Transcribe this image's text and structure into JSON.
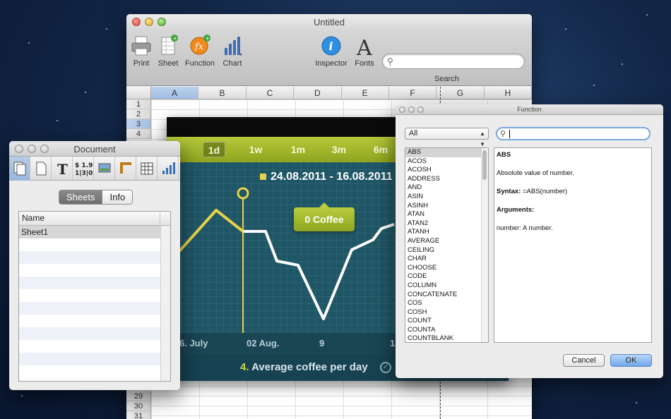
{
  "main_window": {
    "title": "Untitled",
    "toolbar": {
      "print": "Print",
      "sheet": "Sheet",
      "function": "Function",
      "chart": "Chart",
      "inspector": "Inspector",
      "fonts": "Fonts",
      "search": "Search"
    },
    "columns": [
      "A",
      "B",
      "C",
      "D",
      "E",
      "F",
      "G",
      "H"
    ],
    "rows_top": [
      "1",
      "2",
      "3",
      "4"
    ],
    "rows_bottom": [
      "29",
      "30",
      "31"
    ],
    "selected_column": "A",
    "selected_row": "3"
  },
  "coffee_chart": {
    "tabs": [
      "1d",
      "1w",
      "1m",
      "3m",
      "6m"
    ],
    "active_tab": "1d",
    "date_range": "24.08.2011 - 16.08.2011",
    "bubble": "0 Coffee",
    "x_labels": [
      "6. July",
      "02 Aug.",
      "9",
      "1"
    ],
    "caption_number": "4.",
    "caption_text": "Average coffee per day",
    "accent_color": "#b6c93a",
    "line_color_highlight": "#e8d24a",
    "line_color": "#ffffff"
  },
  "document_window": {
    "title": "Document",
    "tabs": [
      "Sheets",
      "Info"
    ],
    "active_tab": "Sheets",
    "list_header": "Name",
    "sheets": [
      "Sheet1"
    ]
  },
  "function_window": {
    "title": "Function",
    "category": "All",
    "search_value": "",
    "functions": [
      "ABS",
      "ACOS",
      "ACOSH",
      "ADDRESS",
      "AND",
      "ASIN",
      "ASINH",
      "ATAN",
      "ATAN2",
      "ATANH",
      "AVERAGE",
      "CEILING",
      "CHAR",
      "CHOOSE",
      "CODE",
      "COLUMN",
      "CONCATENATE",
      "COS",
      "COSH",
      "COUNT",
      "COUNTA",
      "COUNTBLANK"
    ],
    "selected_function": "ABS",
    "description": {
      "name": "ABS",
      "summary": "Absolute value of number.",
      "syntax_label": "Syntax:",
      "syntax": "=ABS(number)",
      "arguments_label": "Arguments:",
      "arguments": "number: A number."
    },
    "cancel": "Cancel",
    "ok": "OK"
  }
}
